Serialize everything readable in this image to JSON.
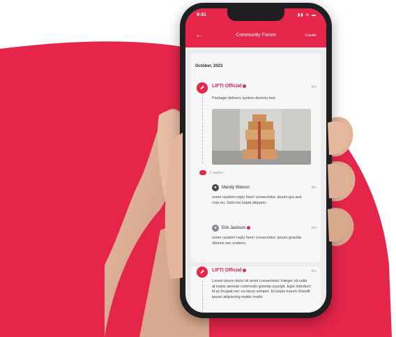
{
  "status": {
    "time": "9:41",
    "icons": "▮▮ ≋ ▬"
  },
  "appbar": {
    "title": "Community Forum",
    "create_label": "Create"
  },
  "feed": {
    "date": "October, 2023",
    "posts": [
      {
        "author": "LIFTI Official",
        "time": "4m",
        "text": "Package delivery system dummy text",
        "replies_label": "2 replies",
        "replies": [
          {
            "name": "Mandy Watson",
            "time": "4m",
            "text": "some random reply here! consectetur. ipsum gra sed cras eu. Sed non luipat aliquam."
          },
          {
            "name": "Erik Jackson",
            "time": "2m",
            "text": "some random reply here! consectetur. ipsum gravida ultrices nec sceleris."
          }
        ]
      },
      {
        "author": "LIFTI Official",
        "time": "4m",
        "text": "Lorem ipsum dolor sit amet consectetur. Integer sit nulla at turpis aenean commodo gravida suscipit. Eget interdum id ac feugiat nec eu lacus semper. Et turpis mauris blandit ipsum adipiscing mattis morbi."
      }
    ]
  },
  "colors": {
    "accent": "#e5254a",
    "background_blob": "#e5254a",
    "phone_frame": "#1f1f22"
  }
}
